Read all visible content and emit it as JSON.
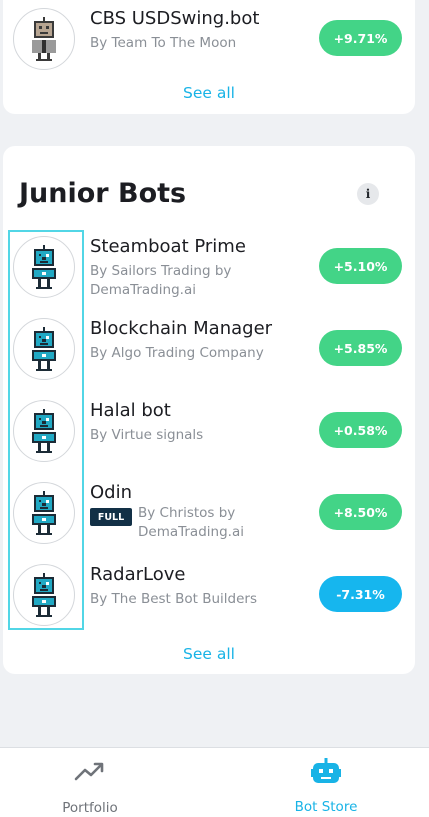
{
  "top_section": {
    "bots": [
      {
        "name": "CBS USDSwing.bot",
        "author": "By Team To The Moon",
        "performance": "+9.71%",
        "trend": "positive",
        "avatar": "grey-robot-icon"
      }
    ],
    "see_all": "See all"
  },
  "junior_section": {
    "title": "Junior Bots",
    "info_icon": "i",
    "bots": [
      {
        "name": "Steamboat Prime",
        "author_line1": "By Sailors Trading by",
        "author_line2": "DemaTrading.ai",
        "performance": "+5.10%",
        "trend": "positive",
        "avatar": "blue-robot-icon"
      },
      {
        "name": "Blockchain Manager",
        "author_line1": "By Algo Trading Company",
        "performance": "+5.85%",
        "trend": "positive",
        "avatar": "blue-robot-icon"
      },
      {
        "name": "Halal bot",
        "author_line1": "By Virtue signals",
        "performance": "+0.58%",
        "trend": "positive",
        "avatar": "blue-robot-icon"
      },
      {
        "name": "Odin",
        "badge": "FULL",
        "author_line1": "By Christos by",
        "author_line2": "DemaTrading.ai",
        "performance": "+8.50%",
        "trend": "positive",
        "avatar": "blue-robot-icon"
      },
      {
        "name": "RadarLove",
        "author_line1": "By The Best Bot Builders",
        "performance": "-7.31%",
        "trend": "negative",
        "avatar": "blue-robot-icon"
      }
    ],
    "see_all": "See all"
  },
  "tab_bar": {
    "tabs": [
      {
        "label": "Portfolio",
        "icon": "trend-line-icon",
        "active": false
      },
      {
        "label": "Bot Store",
        "icon": "robot-icon",
        "active": true
      }
    ]
  },
  "colors": {
    "positive": "#43d487",
    "negative": "#16b6ee",
    "accent": "#18b3e6",
    "badge": "#123046",
    "selection": "#52d6e6"
  }
}
